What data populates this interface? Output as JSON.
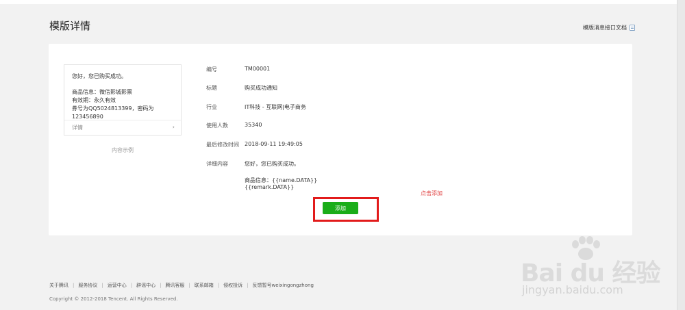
{
  "header": {
    "title": "模版详情",
    "doc_link": "模版消息接口文档"
  },
  "preview": {
    "greeting": "您好，您已购买成功。",
    "lines": [
      "商品信息：微信影城影票",
      "有效期：永久有效",
      "券号为QQ5024813399，密码为123456890"
    ],
    "more_label": "详情",
    "more_chevron": "›",
    "caption": "内容示例"
  },
  "fields": [
    {
      "label": "编号",
      "value": "TM00001"
    },
    {
      "label": "标题",
      "value": "购买成功通知"
    },
    {
      "label": "行业",
      "value": "IT科技 - 互联网|电子商务"
    },
    {
      "label": "使用人数",
      "value": "35340"
    },
    {
      "label": "最后修改时间",
      "value": "2018-09-11 19:49:05"
    }
  ],
  "content": {
    "label": "详细内容",
    "lines": [
      "您好，您已购买成功。",
      "",
      "商品信息：{{name.DATA}}",
      "{{remark.DATA}}"
    ]
  },
  "annotation": {
    "text": "点击添加",
    "color": "#e04040",
    "box_color": "#e21b1b"
  },
  "add_button": {
    "label": "添加",
    "color": "#1aad19"
  },
  "footer": {
    "links": [
      "关于腾讯",
      "服务协议",
      "运营中心",
      "辟谣中心",
      "腾讯客服",
      "联系邮箱",
      "侵权投诉",
      "反馈暂号weixingongzhong"
    ],
    "copyright": "Copyright © 2012-2018 Tencent. All Rights Reserved."
  },
  "watermark": {
    "brand": "Bai du 经验",
    "url": "jingyan.baidu.com"
  }
}
